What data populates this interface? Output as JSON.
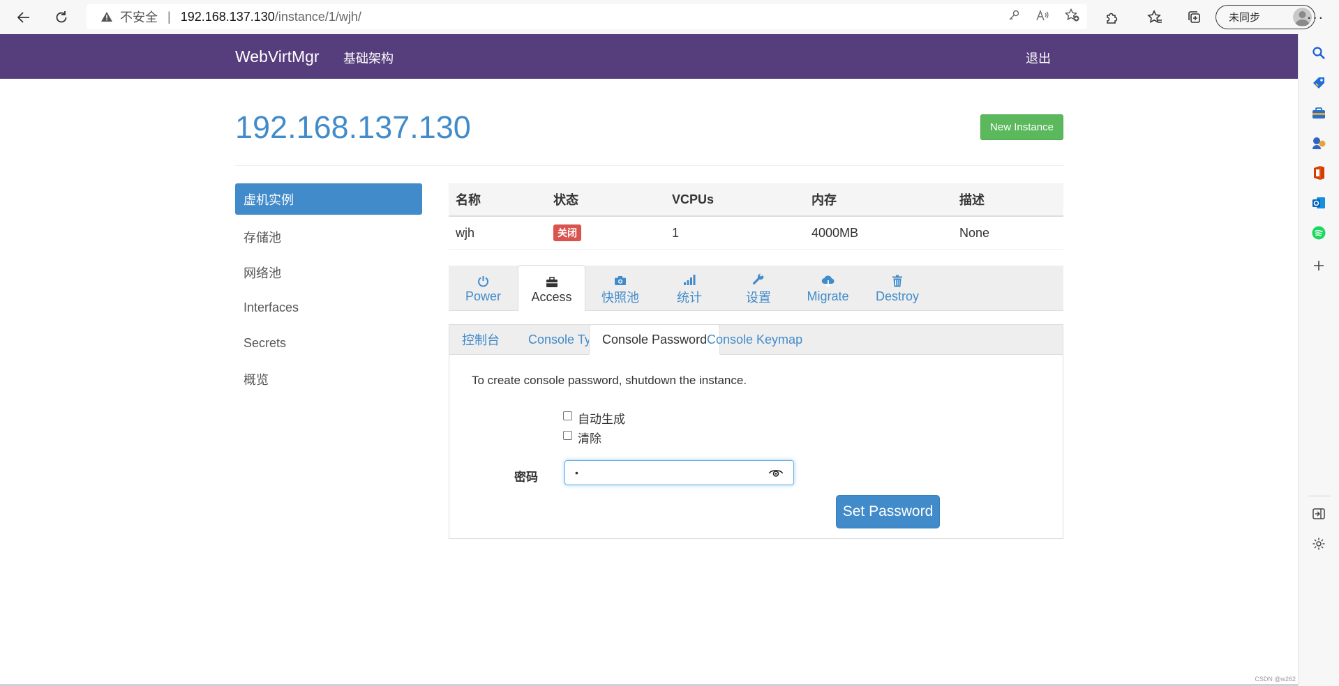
{
  "browser": {
    "insecure_label": "不安全",
    "separator": "|",
    "url_host": "192.168.137.130",
    "url_path": "/instance/1/wjh/",
    "sync_label": "未同步",
    "more": "···"
  },
  "navbar": {
    "brand": "WebVirtMgr",
    "infrastructure": "基础架构",
    "logout": "退出",
    "color": "#563d7c"
  },
  "header": {
    "host": "192.168.137.130",
    "new_instance": "New Instance"
  },
  "sidebar": {
    "items": [
      {
        "label": "虚机实例",
        "active": true
      },
      {
        "label": "存储池"
      },
      {
        "label": "网络池"
      },
      {
        "label": "Interfaces"
      },
      {
        "label": "Secrets"
      },
      {
        "label": "概览"
      }
    ]
  },
  "table": {
    "headers": [
      "名称",
      "状态",
      "VCPUs",
      "内存",
      "描述"
    ],
    "row": {
      "name": "wjh",
      "status": "关闭",
      "vcpus": "1",
      "memory": "4000MB",
      "desc": "None"
    }
  },
  "actions": {
    "tabs": [
      {
        "label": "Power",
        "icon": "power-icon"
      },
      {
        "label": "Access",
        "icon": "briefcase-icon",
        "active": true
      },
      {
        "label": "快照池",
        "icon": "camera-icon"
      },
      {
        "label": "统计",
        "icon": "signal-icon"
      },
      {
        "label": "设置",
        "icon": "wrench-icon"
      },
      {
        "label": "Migrate",
        "icon": "cloud-download-icon"
      },
      {
        "label": "Destroy",
        "icon": "trash-icon"
      }
    ]
  },
  "access": {
    "subtabs": [
      {
        "label": "控制台"
      },
      {
        "label": "Console Type"
      },
      {
        "label": "Console Password",
        "active": true
      },
      {
        "label": "Console Keymap"
      }
    ],
    "note": "To create console password, shutdown the instance.",
    "auto_generate": "自动生成",
    "clear": "清除",
    "password_label": "密码",
    "password_value": "•",
    "set_password": "Set Password"
  },
  "watermark": "CSDN @w262"
}
